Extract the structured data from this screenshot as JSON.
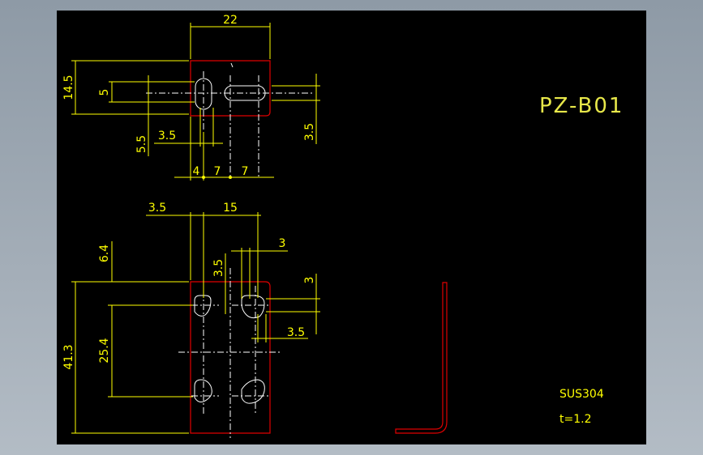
{
  "title": "PZ-B01",
  "material": "SUS304",
  "thickness": "t=1.2",
  "top_view": {
    "width": "22",
    "height": "14.5",
    "slot_height": "5",
    "slot_width": "5.5",
    "slot_offset_x": "3.5",
    "slot_offset_y": "3.5",
    "pitch_a": "4",
    "pitch_b": "7",
    "pitch_c": "7"
  },
  "front_view": {
    "edge_offset": "3.5",
    "hole_pitch": "15",
    "top_margin": "6.4",
    "hole_size": "3",
    "hole_size_v": "3.5",
    "hole_dia_v": "3",
    "hole_dia_h": "3.5",
    "total_height": "41.3",
    "vertical_pitch": "25.4"
  },
  "colors": {
    "background": "#000000",
    "dimension": "#ffff00",
    "outline": "#e00000",
    "centerline": "#ffffff"
  }
}
